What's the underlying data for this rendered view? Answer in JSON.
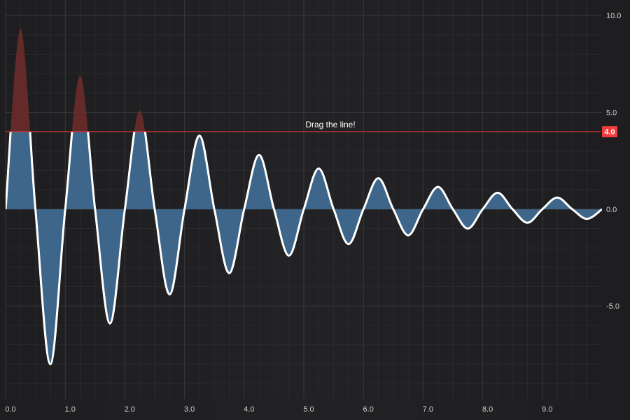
{
  "chart_data": {
    "type": "line",
    "title": "",
    "xlabel": "",
    "ylabel": "",
    "xlim": [
      0,
      10
    ],
    "ylim": [
      -9.8,
      10.8
    ],
    "x_ticks": [
      "0.0",
      "1.0",
      "2.0",
      "3.0",
      "4.0",
      "5.0",
      "6.0",
      "7.0",
      "8.0",
      "9.0"
    ],
    "y_ticks": [
      "10.0",
      "5.0",
      "0.0",
      "-5.0"
    ],
    "grid": true,
    "legend": "none",
    "series": [
      {
        "color": "#ffffff",
        "x": [
          0.0,
          0.25,
          0.5,
          0.75,
          1.0,
          1.25,
          1.5,
          1.75,
          2.0,
          2.25,
          2.5,
          2.75,
          3.0,
          3.25,
          3.5,
          3.75,
          4.0,
          4.25,
          4.5,
          4.75,
          5.0,
          5.25,
          5.5,
          5.75,
          6.0,
          6.25,
          6.5,
          6.75,
          7.0,
          7.25,
          7.5,
          7.75,
          8.0,
          8.25,
          8.5,
          8.75,
          9.0,
          9.25,
          9.5,
          9.75,
          10.0
        ],
        "y": [
          0.0,
          9.3,
          0.0,
          -8.0,
          0.0,
          6.9,
          0.0,
          -5.9,
          0.0,
          5.1,
          0.0,
          -4.4,
          0.0,
          3.8,
          0.0,
          -3.3,
          0.0,
          2.8,
          0.0,
          -2.4,
          0.0,
          2.1,
          0.0,
          -1.8,
          0.0,
          1.6,
          0.0,
          -1.35,
          0.0,
          1.15,
          0.0,
          -1.0,
          0.0,
          0.85,
          0.0,
          -0.7,
          0.0,
          0.6,
          0.0,
          -0.5,
          0.0
        ]
      }
    ],
    "threshold": {
      "value": 4.0,
      "label": "4.0",
      "annotation": "Drag the line!",
      "color": "#e03838"
    },
    "fill_colors": {
      "above_threshold": "#6b2a2a",
      "below_threshold": "#3f6a90"
    }
  }
}
